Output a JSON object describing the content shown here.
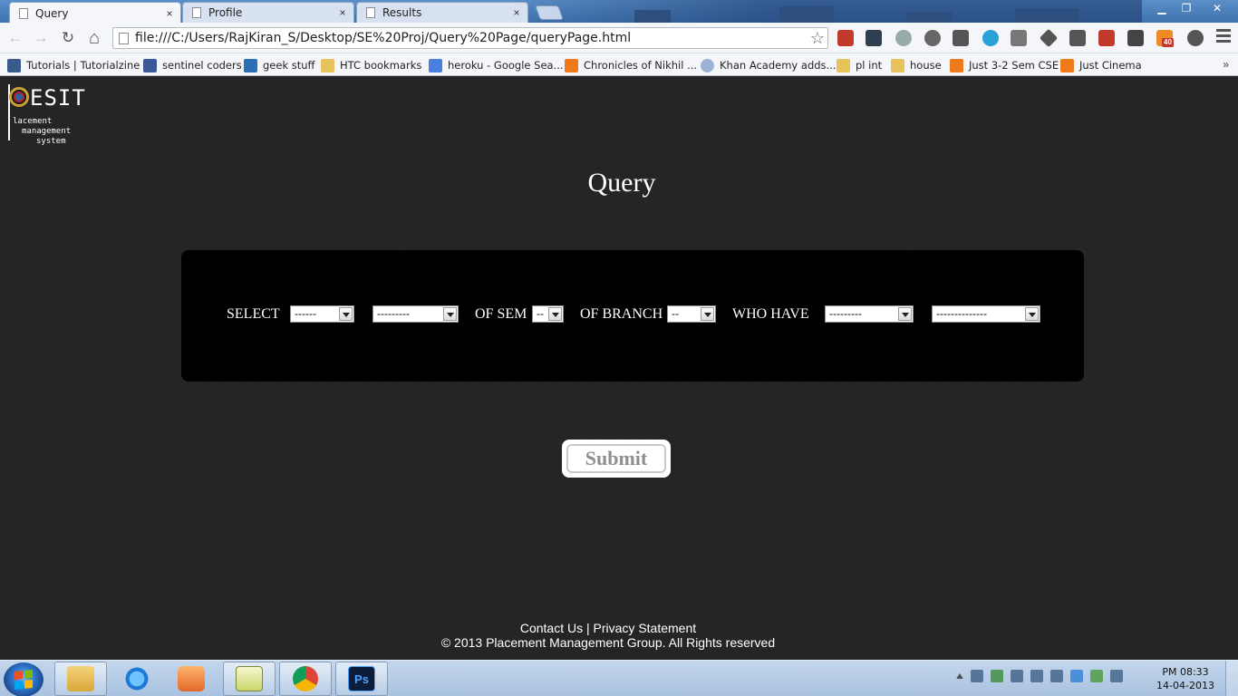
{
  "browser": {
    "tabs": [
      {
        "title": "Query",
        "close": "×"
      },
      {
        "title": "Profile",
        "close": "×"
      },
      {
        "title": "Results",
        "close": "×"
      }
    ],
    "window_controls": {
      "minimize": "▁",
      "restore": "❐",
      "close": "✕"
    },
    "nav": {
      "back": "←",
      "forward": "→",
      "reload": "↻",
      "home": "⌂"
    },
    "url": "file:///C:/Users/RajKiran_S/Desktop/SE%20Proj/Query%20Page/queryPage.html",
    "star": "☆",
    "extension_badge": "40",
    "bookmarks": [
      {
        "label": "Tutorials | Tutorialzine",
        "color": "#3a5a8c"
      },
      {
        "label": "sentinel coders",
        "color": "#3b5998"
      },
      {
        "label": "geek stuff",
        "color": "#2c6fb5"
      },
      {
        "label": "HTC bookmarks",
        "color": "#e8c25a"
      },
      {
        "label": "heroku - Google Sea...",
        "color": "#4a7fe0"
      },
      {
        "label": "Chronicles of Nikhil ...",
        "color": "#f07a1a"
      },
      {
        "label": "Khan Academy adds...",
        "color": "#9ab3d6"
      },
      {
        "label": "pl int",
        "color": "#e8c25a"
      },
      {
        "label": "house",
        "color": "#e8c25a"
      },
      {
        "label": "Just 3-2 Sem CSE",
        "color": "#f07a1a"
      },
      {
        "label": "Just Cinema",
        "color": "#f07a1a"
      }
    ],
    "bookmarks_more": "»"
  },
  "logo": {
    "title": "ESIT",
    "line1": "lacement",
    "line2": "management",
    "line3": "system"
  },
  "page": {
    "heading": "Query",
    "labels": {
      "select": "SELECT",
      "of_sem": "OF SEM",
      "of_branch": "OF BRANCH",
      "who_have": "WHO HAVE"
    },
    "selects": {
      "field1": "------",
      "field2": "---------",
      "sem": "--",
      "branch": "--",
      "condition": "---------",
      "value": "--------------"
    },
    "submit": "Submit",
    "footer": {
      "contact": "Contact Us",
      "separator": " | ",
      "privacy": "Privacy Statement",
      "copyright": "© 2013 Placement Management Group. All Rights reserved"
    }
  },
  "taskbar": {
    "clock_time": "PM 08:33",
    "clock_date": "14-04-2013",
    "apps": [
      "file-explorer",
      "internet-explorer",
      "media-player",
      "notepad",
      "chrome",
      "photoshop"
    ]
  }
}
